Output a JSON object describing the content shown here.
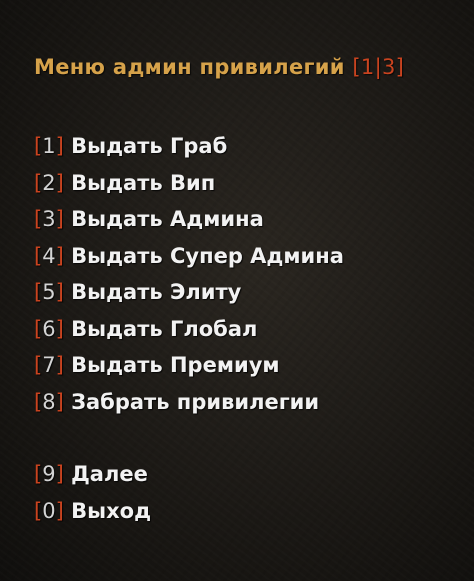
{
  "menu": {
    "title": "Меню админ привилегий",
    "page": "1",
    "page_sep": "|",
    "page_total": "3",
    "items": [
      {
        "key": "1",
        "label": "Выдать Граб"
      },
      {
        "key": "2",
        "label": "Выдать Вип"
      },
      {
        "key": "3",
        "label": "Выдать Админа"
      },
      {
        "key": "4",
        "label": "Выдать Супер Админа"
      },
      {
        "key": "5",
        "label": "Выдать Элиту"
      },
      {
        "key": "6",
        "label": "Выдать Глобал"
      },
      {
        "key": "7",
        "label": "Выдать Премиум"
      },
      {
        "key": "8",
        "label": "Забрать привилегии"
      }
    ],
    "nav": [
      {
        "key": "9",
        "label": "Далее"
      },
      {
        "key": "0",
        "label": "Выход"
      }
    ]
  },
  "colors": {
    "title": "#d6a24a",
    "bracket": "#c9431f",
    "item_text": "#f2f2f2",
    "background": "#1f1c18"
  }
}
